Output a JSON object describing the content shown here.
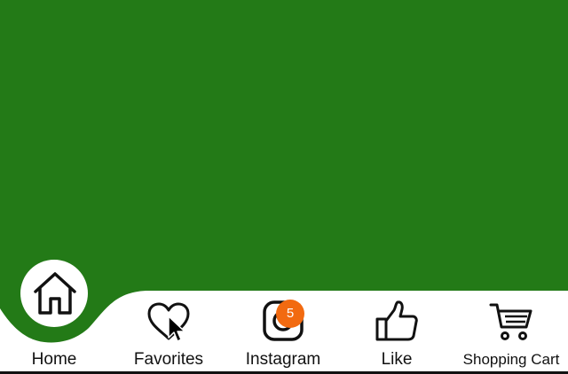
{
  "colors": {
    "background": "#237a17",
    "tabbar": "#ffffff",
    "badge": "#f26a10",
    "text": "#111111"
  },
  "tabs": [
    {
      "label": "Home",
      "icon": "home-icon",
      "active": true
    },
    {
      "label": "Favorites",
      "icon": "heart-icon"
    },
    {
      "label": "Instagram",
      "icon": "instagram-icon",
      "badge": "5"
    },
    {
      "label": "Like",
      "icon": "thumbs-up-icon"
    },
    {
      "label": "Shopping Cart",
      "icon": "shopping-cart-icon"
    }
  ]
}
